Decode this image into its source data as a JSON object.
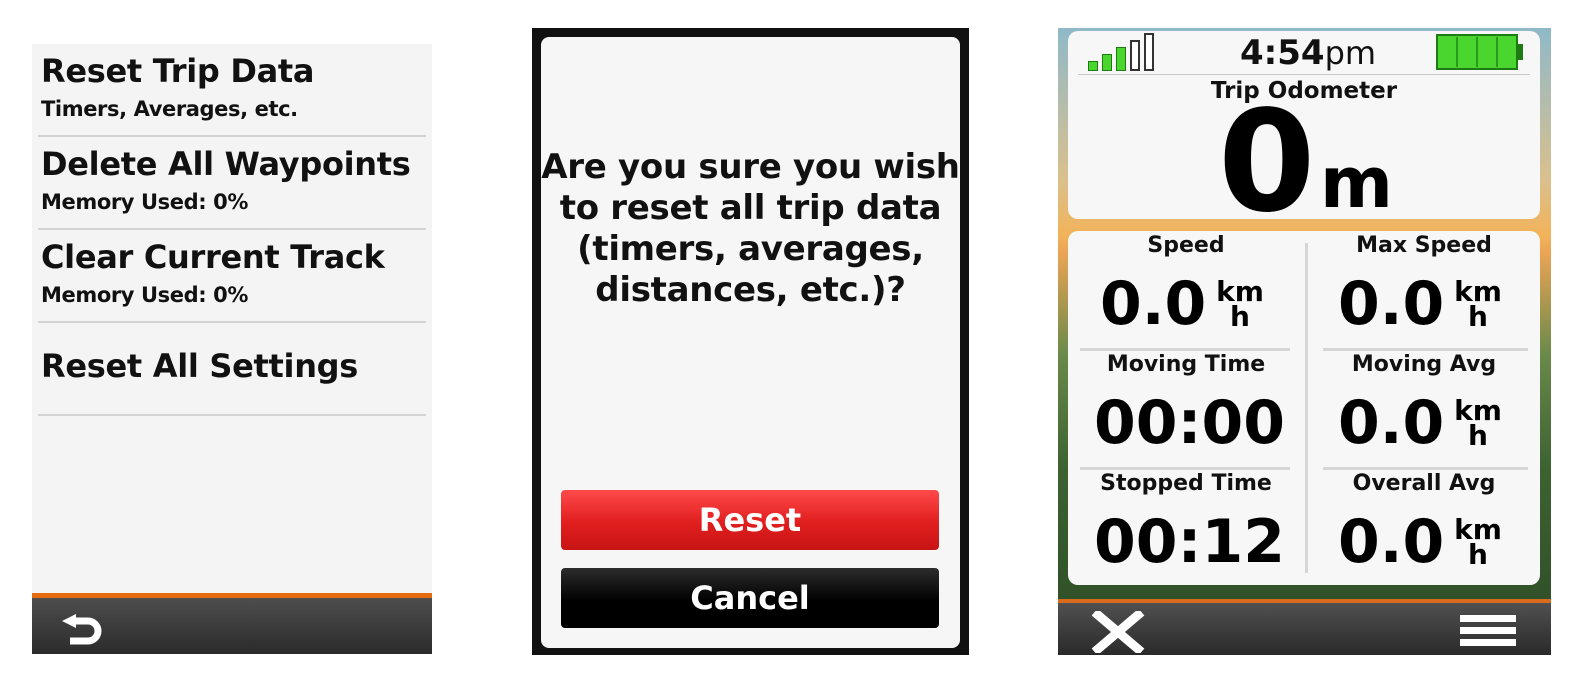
{
  "reset_menu": {
    "items": [
      {
        "title": "Reset Trip Data",
        "subtitle": "Timers, Averages, etc."
      },
      {
        "title": "Delete All Waypoints",
        "subtitle": "Memory Used: 0%"
      },
      {
        "title": "Clear Current Track",
        "subtitle": "Memory Used: 0%"
      },
      {
        "title": "Reset All Settings",
        "subtitle": ""
      }
    ],
    "back_icon": "back-arrow-icon",
    "accent_color": "#e46b10"
  },
  "confirm_dialog": {
    "message": "Are you sure you wish to reset all trip data (timers, averages, distances, etc.)?",
    "reset_label": "Reset",
    "cancel_label": "Cancel",
    "reset_color": "#e01e1e",
    "cancel_color": "#000000"
  },
  "trip_computer": {
    "status": {
      "signal_bars": 5,
      "signal_filled": 3,
      "time": "4:54",
      "ampm": "pm",
      "battery_level": 1.0,
      "battery_color": "#4bd62f"
    },
    "odometer": {
      "label": "Trip Odometer",
      "value": "0",
      "unit": "m"
    },
    "fields": [
      {
        "label": "Speed",
        "value": "0.0",
        "unit_top": "km",
        "unit_bottom": "h"
      },
      {
        "label": "Max Speed",
        "value": "0.0",
        "unit_top": "km",
        "unit_bottom": "h"
      },
      {
        "label": "Moving Time",
        "value": "00:00",
        "unit_top": "",
        "unit_bottom": ""
      },
      {
        "label": "Moving Avg",
        "value": "0.0",
        "unit_top": "km",
        "unit_bottom": "h"
      },
      {
        "label": "Stopped Time",
        "value": "00:12",
        "unit_top": "",
        "unit_bottom": ""
      },
      {
        "label": "Overall Avg",
        "value": "0.0",
        "unit_top": "km",
        "unit_bottom": "h"
      }
    ],
    "close_icon": "close-icon",
    "menu_icon": "menu-icon"
  }
}
